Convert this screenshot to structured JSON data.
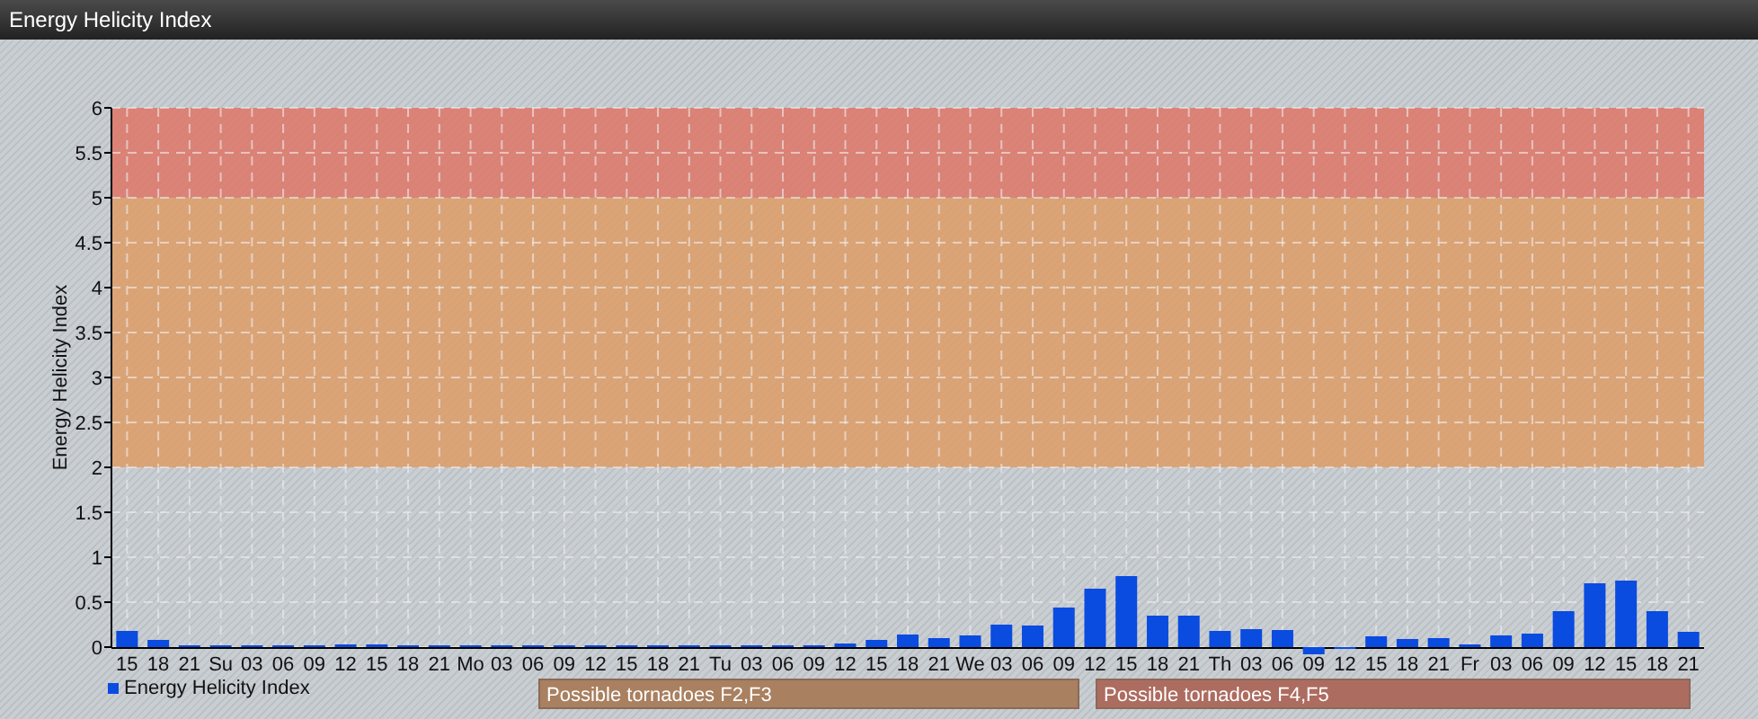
{
  "window": {
    "title": "Energy Helicity Index"
  },
  "chart": {
    "chart_data": {
      "type": "bar",
      "ylabel": "Energy Helicity Index",
      "categories": [
        "15",
        "18",
        "21",
        "Su",
        "03",
        "06",
        "09",
        "12",
        "15",
        "18",
        "21",
        "Mo",
        "03",
        "06",
        "09",
        "12",
        "15",
        "18",
        "21",
        "Tu",
        "03",
        "06",
        "09",
        "12",
        "15",
        "18",
        "21",
        "We",
        "03",
        "06",
        "09",
        "12",
        "15",
        "18",
        "21",
        "Th",
        "03",
        "06",
        "09",
        "12",
        "15",
        "18",
        "21",
        "Fr",
        "03",
        "06",
        "09",
        "12",
        "15",
        "18",
        "21"
      ],
      "series": [
        {
          "name": "Energy Helicity Index",
          "color": "#0a4be0",
          "values": [
            0.18,
            0.08,
            0.02,
            0.02,
            0.02,
            0.02,
            0.02,
            0.03,
            0.03,
            0.02,
            0.02,
            0.02,
            0.02,
            0.02,
            0.02,
            0.02,
            0.02,
            0.02,
            0.02,
            0.02,
            0.02,
            0.02,
            0.02,
            0.04,
            0.08,
            0.14,
            0.1,
            0.13,
            0.25,
            0.24,
            0.44,
            0.65,
            0.79,
            0.35,
            0.35,
            0.18,
            0.2,
            0.19,
            -0.08,
            -0.02,
            0.12,
            0.09,
            0.1,
            0.03,
            0.13,
            0.15,
            0.4,
            0.71,
            0.74,
            0.4,
            0.17
          ]
        }
      ],
      "ylim": [
        -0.1,
        6
      ],
      "yticks": [
        0,
        0.5,
        1,
        1.5,
        2,
        2.5,
        3,
        3.5,
        4,
        4.5,
        5,
        5.5,
        6
      ],
      "grid": true,
      "bands": [
        {
          "axis": "y",
          "from": 2,
          "to": 5,
          "color": "#e09a60"
        },
        {
          "axis": "y",
          "from": 5,
          "to": 6,
          "color": "#e07060"
        }
      ]
    },
    "risk_legend": [
      {
        "label": "Possible tornadoes F2,F3",
        "color": "#a98060"
      },
      {
        "label": "Possible tornadoes F4,F5",
        "color": "#ad6c60"
      }
    ]
  }
}
